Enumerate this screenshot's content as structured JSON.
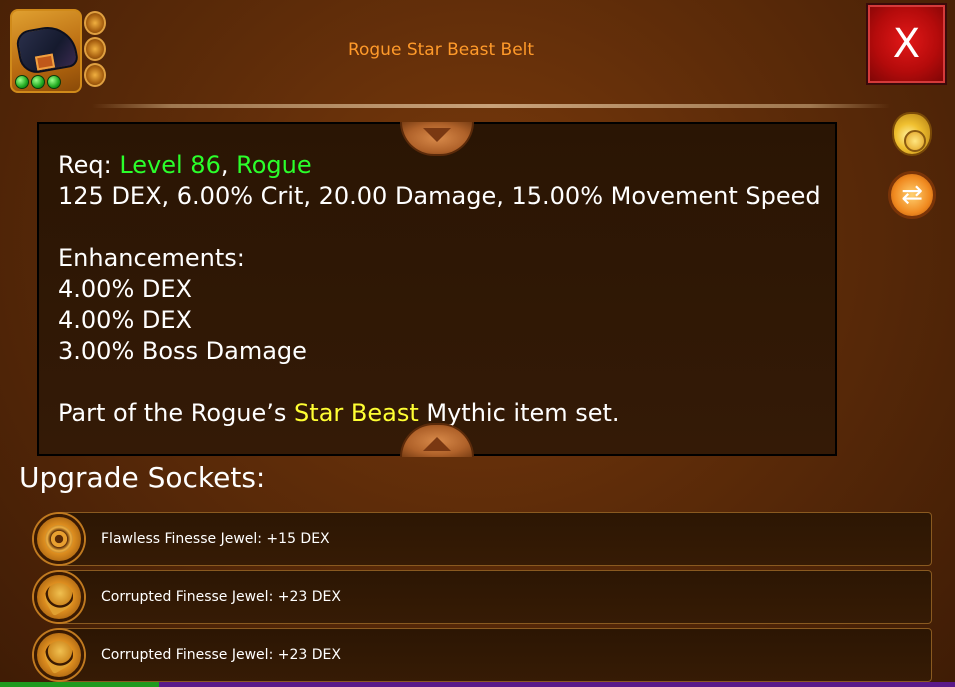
{
  "item": {
    "title": "Rogue Star Beast Belt",
    "icon": "belt-icon",
    "rarity_dots": 3,
    "mini_sockets": 3
  },
  "close_button": {
    "label": "X"
  },
  "side_buttons": [
    {
      "icon": "coin-bag-icon"
    },
    {
      "icon": "swap-icon"
    }
  ],
  "description": {
    "req_label": "Req: ",
    "req_level": "Level 86",
    "req_sep": ", ",
    "req_class": "Rogue",
    "stats": "125 DEX, 6.00% Crit, 20.00 Damage, 15.00% Movement Speed",
    "enhancements_heading": "Enhancements:",
    "enhancements": [
      "4.00% DEX",
      "4.00% DEX",
      "3.00% Boss Damage"
    ],
    "set_prefix": "Part of the Rogue’s ",
    "set_name": "Star Beast",
    "set_suffix": " Mythic item set."
  },
  "sockets": {
    "heading": "Upgrade Sockets:",
    "items": [
      {
        "label": "Flawless Finesse Jewel: +15 DEX",
        "icon": "flawless-jewel-icon"
      },
      {
        "label": "Corrupted Finesse Jewel: +23 DEX",
        "icon": "corrupted-jewel-icon"
      },
      {
        "label": "Corrupted Finesse Jewel: +23 DEX",
        "icon": "corrupted-jewel-icon"
      }
    ]
  },
  "colors": {
    "title": "#ff9a2a",
    "requirement": "#2bff2b",
    "set_name": "#ffff33",
    "close_button": "#c40f0f",
    "bottom_bar": [
      "#1e9a1e",
      "#5a1a8a",
      "#5a1a8a",
      "#5a1a8a",
      "#5a1a8a",
      "#5a1a8a"
    ]
  }
}
